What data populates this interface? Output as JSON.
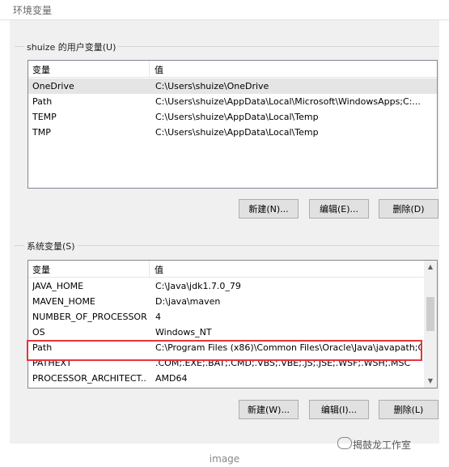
{
  "window": {
    "title": "环境变量"
  },
  "user_vars": {
    "group_label": "shuize 的用户变量(U)",
    "columns": [
      "变量",
      "值"
    ],
    "rows": [
      {
        "name": "OneDrive",
        "value": "C:\\Users\\shuize\\OneDrive",
        "selected": true
      },
      {
        "name": "Path",
        "value": "C:\\Users\\shuize\\AppData\\Local\\Microsoft\\WindowsApps;C:..."
      },
      {
        "name": "TEMP",
        "value": "C:\\Users\\shuize\\AppData\\Local\\Temp"
      },
      {
        "name": "TMP",
        "value": "C:\\Users\\shuize\\AppData\\Local\\Temp"
      }
    ],
    "buttons": {
      "new": "新建(N)...",
      "edit": "编辑(E)...",
      "delete": "删除(D)"
    }
  },
  "system_vars": {
    "group_label": "系统变量(S)",
    "columns": [
      "变量",
      "值"
    ],
    "rows": [
      {
        "name": "JAVA_HOME",
        "value": "C:\\Java\\jdk1.7.0_79"
      },
      {
        "name": "MAVEN_HOME",
        "value": "D:\\java\\maven"
      },
      {
        "name": "NUMBER_OF_PROCESSORS",
        "value": "4"
      },
      {
        "name": "OS",
        "value": "Windows_NT"
      },
      {
        "name": "Path",
        "value": "C:\\Program Files (x86)\\Common Files\\Oracle\\Java\\javapath;C:...",
        "highlighted": true
      },
      {
        "name": "PATHEXT",
        "value": ".COM;.EXE;.BAT;.CMD;.VBS;.VBE;.JS;.JSE;.WSF;.WSH;.MSC"
      },
      {
        "name": "PROCESSOR_ARCHITECT...",
        "value": "AMD64"
      }
    ],
    "buttons": {
      "new": "新建(W)...",
      "edit": "编辑(I)...",
      "delete": "删除(L)"
    }
  },
  "caption": "image",
  "watermark": "揭鼓龙工作室",
  "colors": {
    "highlight_box": "#e8343a",
    "selected_row": "#e5e5e5"
  }
}
